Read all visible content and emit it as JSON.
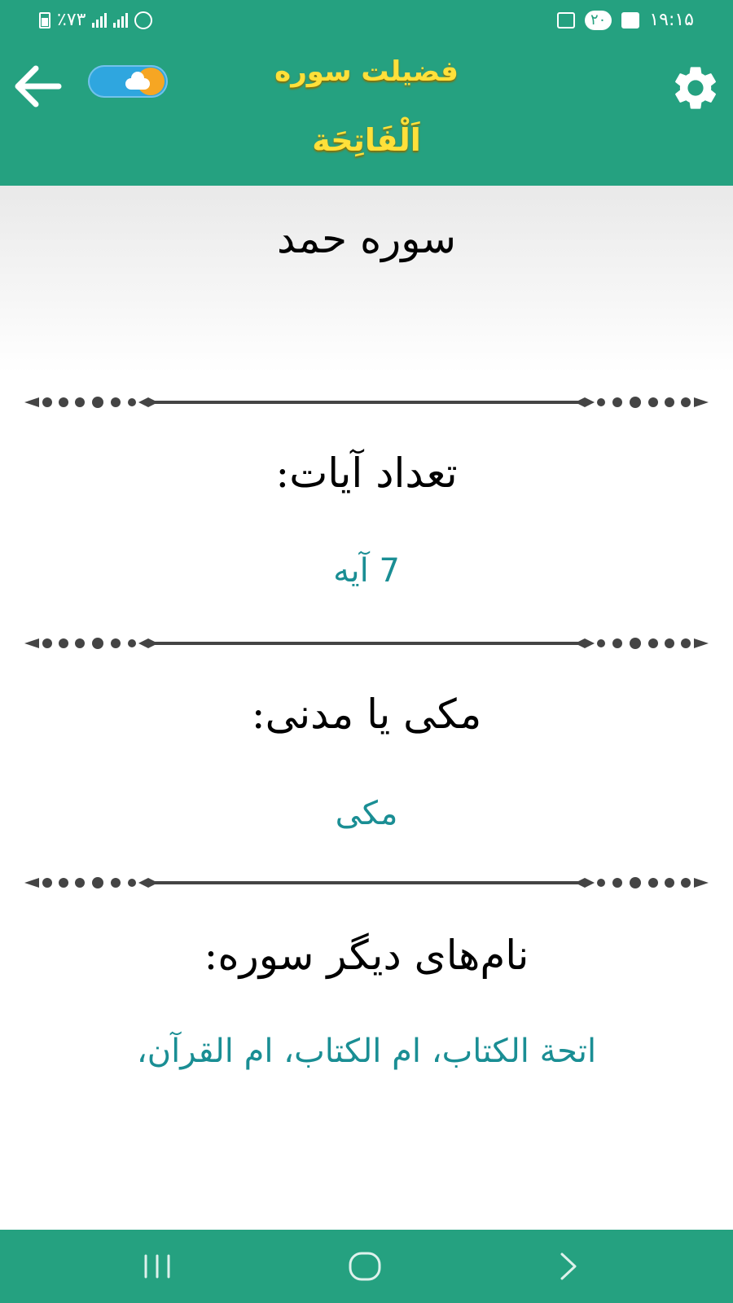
{
  "status_bar": {
    "time": "۱۹:۱۵",
    "battery": "٪۷۳",
    "notification_badge": "۲۰"
  },
  "app_bar": {
    "title_line1": "فضیلت سوره",
    "title_line2": "اَلْفَاتِحَة",
    "toggle_state": "day"
  },
  "content": {
    "surah_name": "سوره حمد",
    "verse_count_label": "تعداد آیات:",
    "verse_count_value": "7 آیه",
    "revelation_label": "مکی یا مدنی:",
    "revelation_value": "مکی",
    "other_names_label": "نام‌های دیگر سوره:",
    "other_names_value": "اتحة الکتاب، ام الکتاب، ام القرآن،"
  },
  "colors": {
    "primary": "#25a180",
    "title": "#ffe03a",
    "value_text": "#1a8e94",
    "divider": "#444444"
  },
  "icons": {
    "back": "arrow-left-icon",
    "settings": "gear-icon",
    "toggle": "sun-cloud-icon",
    "nav_recents": "recents-icon",
    "nav_home": "home-icon",
    "nav_back": "chevron-icon"
  }
}
